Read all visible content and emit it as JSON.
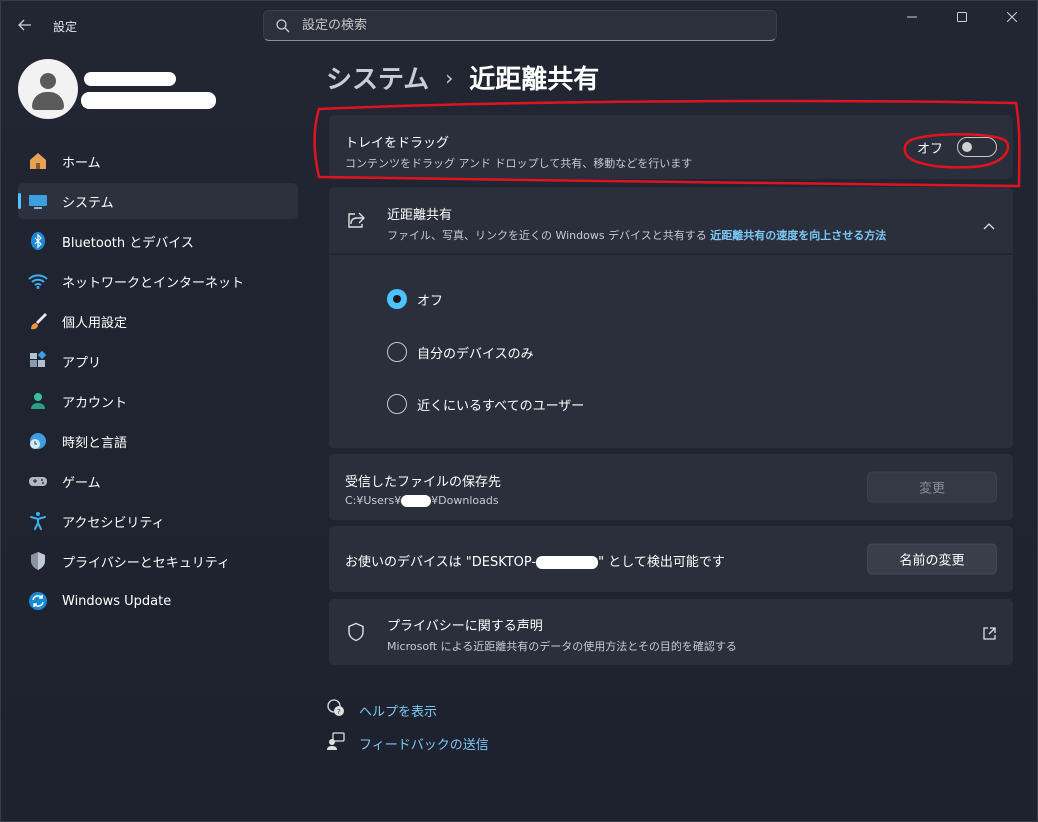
{
  "app": {
    "title": "設定",
    "search_placeholder": "設定の検索"
  },
  "sidebar": {
    "items": [
      {
        "label": "ホーム",
        "icon": "home-icon"
      },
      {
        "label": "システム",
        "icon": "system-icon",
        "active": true
      },
      {
        "label": "Bluetooth とデバイス",
        "icon": "bluetooth-icon"
      },
      {
        "label": "ネットワークとインターネット",
        "icon": "network-icon"
      },
      {
        "label": "個人用設定",
        "icon": "brush-icon"
      },
      {
        "label": "アプリ",
        "icon": "apps-icon"
      },
      {
        "label": "アカウント",
        "icon": "account-icon"
      },
      {
        "label": "時刻と言語",
        "icon": "time-language-icon"
      },
      {
        "label": "ゲーム",
        "icon": "game-icon"
      },
      {
        "label": "アクセシビリティ",
        "icon": "accessibility-icon"
      },
      {
        "label": "プライバシーとセキュリティ",
        "icon": "shield-icon"
      },
      {
        "label": "Windows Update",
        "icon": "update-icon"
      }
    ]
  },
  "breadcrumb": {
    "parent": "システム",
    "separator": "›",
    "current": "近距離共有"
  },
  "drag_tray": {
    "title": "トレイをドラッグ",
    "description": "コンテンツをドラッグ アンド ドロップして共有、移動などを行います",
    "toggle_label": "オフ"
  },
  "nearby_sharing": {
    "title": "近距離共有",
    "description": "ファイル、写真、リンクを近くの Windows デバイスと共有する",
    "link": "近距離共有の速度を向上させる方法",
    "options": [
      {
        "label": "オフ",
        "checked": true
      },
      {
        "label": "自分のデバイスのみ",
        "checked": false
      },
      {
        "label": "近くにいるすべてのユーザー",
        "checked": false
      }
    ]
  },
  "save_location": {
    "title": "受信したファイルの保存先",
    "path_prefix": "C:¥Users¥",
    "path_suffix": "¥Downloads",
    "button": "変更"
  },
  "device_name": {
    "prefix": "お使いのデバイスは \"DESKTOP-",
    "suffix": "\" として検出可能です",
    "button": "名前の変更"
  },
  "privacy": {
    "title": "プライバシーに関する声明",
    "description": "Microsoft による近距離共有のデータの使用方法とその目的を確認する"
  },
  "footer": {
    "help": "ヘルプを表示",
    "feedback": "フィードバックの送信"
  },
  "colors": {
    "accent": "#4cc2ff",
    "link": "#7cc8f5",
    "annotation": "#e0141e"
  }
}
